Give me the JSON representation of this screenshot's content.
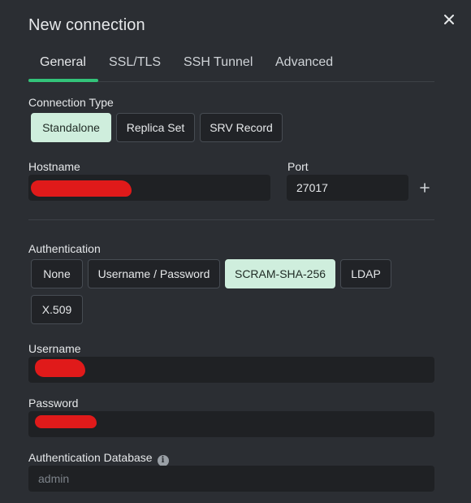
{
  "dialog": {
    "title": "New connection",
    "close_icon": "close-icon"
  },
  "tabs": [
    {
      "label": "General",
      "active": true
    },
    {
      "label": "SSL/TLS",
      "active": false
    },
    {
      "label": "SSH Tunnel",
      "active": false
    },
    {
      "label": "Advanced",
      "active": false
    }
  ],
  "connection_type": {
    "label": "Connection Type",
    "options": [
      "Standalone",
      "Replica Set",
      "SRV Record"
    ],
    "selected": "Standalone"
  },
  "host": {
    "hostname_label": "Hostname",
    "hostname_value": "",
    "port_label": "Port",
    "port_value": "27017",
    "add_icon": "plus-icon"
  },
  "authentication": {
    "label": "Authentication",
    "options": [
      "None",
      "Username / Password",
      "SCRAM-SHA-256",
      "LDAP",
      "X.509"
    ],
    "selected": "SCRAM-SHA-256"
  },
  "username": {
    "label": "Username",
    "value": ""
  },
  "password": {
    "label": "Password",
    "value": ""
  },
  "auth_db": {
    "label": "Authentication Database",
    "placeholder": "admin",
    "info_icon": "info-icon"
  },
  "colors": {
    "accent": "#33c37a",
    "selected_bg": "#cfeedd",
    "background": "#2b2e33",
    "input_bg": "#1f2124",
    "redaction": "#e01a1a"
  }
}
